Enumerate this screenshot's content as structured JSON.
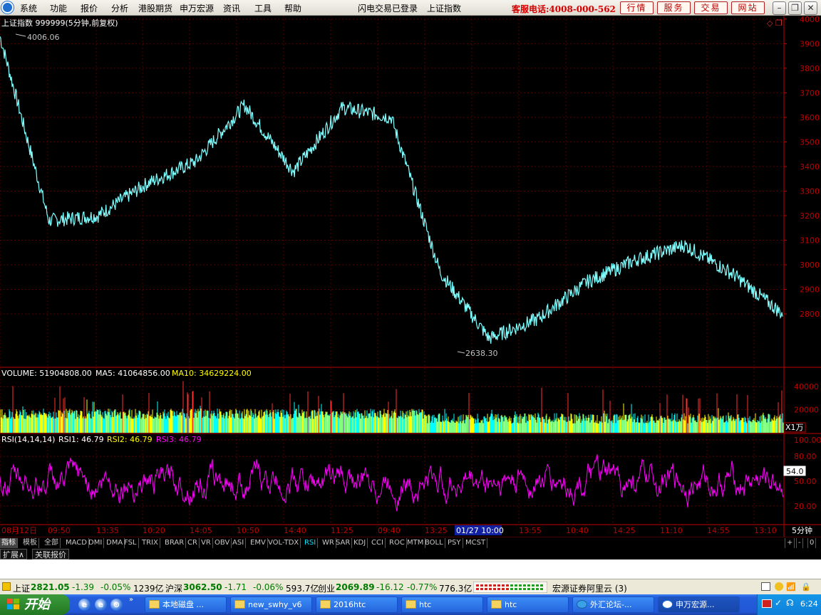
{
  "menu": {
    "items": [
      "系统",
      "功能",
      "报价",
      "分析",
      "港股期货",
      "申万宏源",
      "资讯",
      "工具",
      "帮助"
    ],
    "login_status": "闪电交易已登录",
    "current_index": "上证指数",
    "hotline": "客服电话:4008-000-562",
    "buttons": [
      "行情",
      "服务",
      "交易",
      "网站"
    ]
  },
  "chart": {
    "title": "上证指数 999999(5分钟,前复权)",
    "price_axis": [
      "4000",
      "3900",
      "3800",
      "3700",
      "3600",
      "3500",
      "3400",
      "3300",
      "3200",
      "3100",
      "3000",
      "2900",
      "2800"
    ],
    "max_label": "4006.06",
    "min_label": "2638.30",
    "volume_header": {
      "volume": "VOLUME: 51904808.00",
      "ma5": "MA5: 41064856.00",
      "ma10": "MA10: 34629224.00"
    },
    "volume_axis": [
      "40000",
      "20000"
    ],
    "volume_unit": "X1万",
    "rsi_header": {
      "name": "RSI(14,14,14)",
      "rsi1": "RSI1: 46.79",
      "rsi2": "RSI2: 46.79",
      "rsi3": "RSI3: 46.79"
    },
    "rsi_axis": [
      "100.00",
      "80.00",
      "50.00",
      "20.00"
    ],
    "rsi_current": "54.0",
    "time_axis": [
      "08月12日",
      "09:50",
      "13:35",
      "10:20",
      "14:05",
      "10:50",
      "14:40",
      "11:25",
      "09:40",
      "13:25",
      "01/27 10:00",
      "13:55",
      "10:40",
      "14:25",
      "11:10",
      "14:55",
      "13:10"
    ],
    "period": "5分钟"
  },
  "chart_data": {
    "type": "line",
    "title": "上证指数 999999(5分钟,前复权)",
    "xlabel": "",
    "ylabel": "",
    "x": [
      "08月12日",
      "09:50",
      "13:35",
      "10:20",
      "14:05",
      "10:50",
      "14:40",
      "11:25",
      "09:40",
      "13:25",
      "01/27 10:00",
      "13:55",
      "10:40",
      "14:25",
      "11:10",
      "14:55",
      "13:10"
    ],
    "series": [
      {
        "name": "",
        "values": [
          3930,
          3180,
          3200,
          3330,
          3420,
          3650,
          3380,
          3640,
          3600,
          2970,
          2700,
          2780,
          2930,
          3020,
          3080,
          2960,
          2800
        ]
      }
    ],
    "ylim": [
      2600,
      4020
    ],
    "max_point": 4006.06,
    "min_point": 2638.3
  },
  "indicator_tabs": [
    "指标",
    "模板",
    "全部",
    "MACD",
    "DMI",
    "DMA",
    "FSL",
    "TRIX",
    "BRAR",
    "CR",
    "VR",
    "OBV",
    "ASI",
    "EMV",
    "VOL-TDX",
    "RSI",
    "WR",
    "SAR",
    "KDJ",
    "CCI",
    "ROC",
    "MTM",
    "BOLL",
    "PSY",
    "MCST"
  ],
  "active_tab": "RSI",
  "scroll_buttons": [
    "+",
    "-",
    "0"
  ],
  "lower_buttons": [
    "扩展∧",
    "关联报价"
  ],
  "status": {
    "sh_label": "上证",
    "sh_value": "2821.05",
    "sh_change": "-1.39",
    "sh_pct": "-0.05%",
    "sh_amount": "1239亿",
    "hs_label": "沪深",
    "hs_value": "3062.50",
    "hs_change": "-1.71",
    "hs_pct": "-0.06%",
    "hs_amount": "593.7亿",
    "cy_label": "创业",
    "cy_value": "2069.89",
    "cy_change": "-16.12",
    "cy_pct": "-0.77%",
    "cy_amount": "776.3亿",
    "broker": "宏源证券阿里云 (3)"
  },
  "taskbar": {
    "start": "开始",
    "tasks": [
      "本地磁盘 ...",
      "new_swhy_v6",
      "2016htc",
      "htc",
      "htc",
      "外汇论坛-...",
      "申万宏源..."
    ],
    "clock": "6:24"
  },
  "colors": {
    "price_line": "#7fffff",
    "grid": "#5a0000",
    "axis": "#c00000",
    "rsi": "#ff00ff",
    "volume_yellow": "#ffff00",
    "volume_cyan": "#00ffff",
    "volume_red": "#ff3030"
  }
}
